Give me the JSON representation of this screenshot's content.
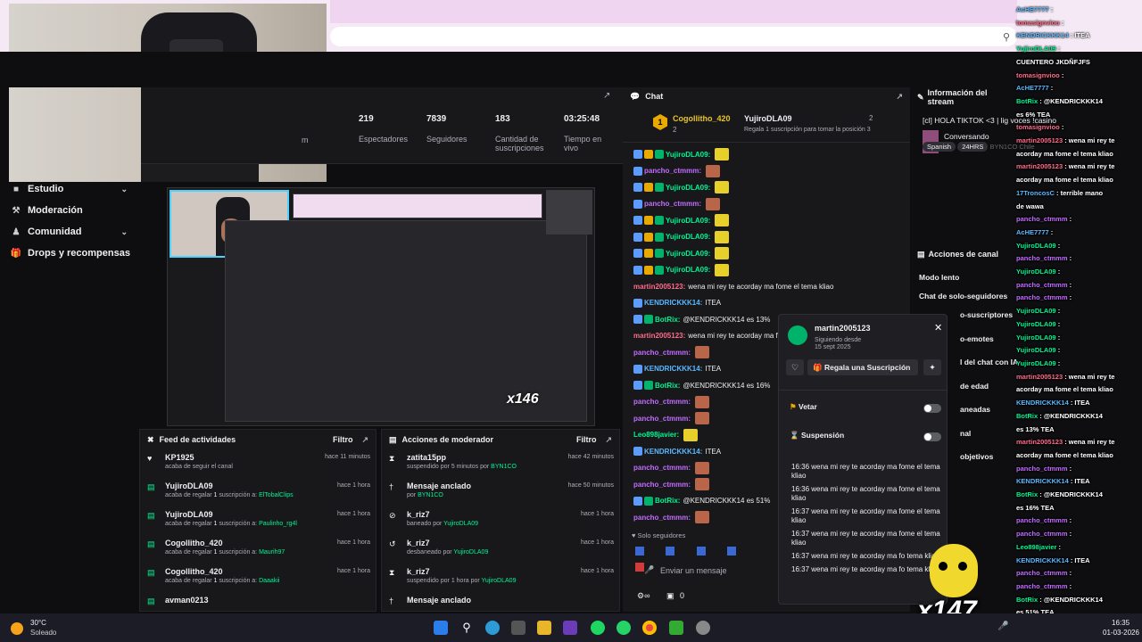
{
  "stats": {
    "m_label": "m",
    "items": [
      {
        "value": "219",
        "label": "Espectadores"
      },
      {
        "value": "7839",
        "label": "Seguidores"
      },
      {
        "value": "183",
        "label": "Cantidad de suscripciones"
      },
      {
        "value": "03:25:48",
        "label": "Tiempo en vivo"
      }
    ]
  },
  "sidebar": {
    "items": [
      {
        "label": "Estudio",
        "icon": "estudio-icon",
        "chevron": true
      },
      {
        "label": "Moderación",
        "icon": "wrench-icon",
        "chevron": false
      },
      {
        "label": "Comunidad",
        "icon": "community-icon",
        "chevron": true
      },
      {
        "label": "Drops y recompensas",
        "icon": "gift-icon",
        "chevron": false
      }
    ]
  },
  "activity_feed": {
    "title": "Feed de actividades",
    "filter": "Filtro",
    "items": [
      {
        "icon": "heart-icon",
        "name": "KP1925",
        "time": "hace 11 minutos",
        "pre": "acaba de seguir el canal",
        "hl": "",
        "post": ""
      },
      {
        "icon": "gift-icon",
        "name": "YujiroDLA09",
        "time": "hace 1 hora",
        "pre": "acaba de regalar ",
        "count": "1",
        "mid": " suscripción a: ",
        "hl": "ElTobalClips"
      },
      {
        "icon": "gift-icon",
        "name": "YujiroDLA09",
        "time": "hace 1 hora",
        "pre": "acaba de regalar ",
        "count": "1",
        "mid": " suscripción a: ",
        "hl": "Paulinho_rg4l"
      },
      {
        "icon": "gift-icon",
        "name": "Cogollitho_420",
        "time": "hace 1 hora",
        "pre": "acaba de regalar ",
        "count": "1",
        "mid": " suscripción a: ",
        "hl": "Maurih97"
      },
      {
        "icon": "gift-icon",
        "name": "Cogollitho_420",
        "time": "hace 1 hora",
        "pre": "acaba de regalar ",
        "count": "1",
        "mid": " suscripción a: ",
        "hl": "Daaakii"
      },
      {
        "icon": "gift-icon",
        "name": "avman0213",
        "time": "",
        "pre": "",
        "count": "",
        "mid": "",
        "hl": ""
      }
    ]
  },
  "mod_actions": {
    "title": "Acciones de moderador",
    "filter": "Filtro",
    "items": [
      {
        "icon": "timeout-icon",
        "name": "zatita15pp",
        "time": "hace 42 minutos",
        "pre": "suspendido por 5 minutos por ",
        "hl": "BYN1CO"
      },
      {
        "icon": "pin-icon",
        "name": "Mensaje anclado",
        "time": "hace 50 minutos",
        "pre": "por ",
        "hl": "BYN1CO"
      },
      {
        "icon": "ban-icon",
        "name": "k_riz7",
        "time": "hace 1 hora",
        "pre": "baneado por ",
        "hl": "YujiroDLA09"
      },
      {
        "icon": "unban-icon",
        "name": "k_riz7",
        "time": "hace 1 hora",
        "pre": "desbaneado por ",
        "hl": "YujiroDLA09"
      },
      {
        "icon": "timeout-icon",
        "name": "k_riz7",
        "time": "hace 1 hora",
        "pre": "suspendido por 1 hora por ",
        "hl": "YujiroDLA09"
      },
      {
        "icon": "pin-icon",
        "name": "Mensaje anclado",
        "time": "",
        "pre": "",
        "hl": ""
      }
    ]
  },
  "chat": {
    "title": "Chat",
    "gift_leader": {
      "name": "Cogollitho_420",
      "count": "2",
      "rank": "1"
    },
    "gift_second": {
      "name": "YujiroDLA09",
      "count": "2"
    },
    "gift_cta": "Regala 1 suscripción para tomar la posición 3",
    "messages": [
      {
        "user": "YujiroDLA09:",
        "color": "#00f593",
        "text": "",
        "emote": "y",
        "badges": [
          "#5c9cff",
          "#e8a900",
          "#00b36b"
        ]
      },
      {
        "user": "pancho_ctmmm:",
        "color": "#c06cff",
        "text": "",
        "emote": "b",
        "badges": [
          "#5c9cff"
        ]
      },
      {
        "user": "YujiroDLA09:",
        "color": "#00f593",
        "text": "",
        "emote": "y",
        "badges": [
          "#5c9cff",
          "#e8a900",
          "#00b36b"
        ]
      },
      {
        "user": "pancho_ctmmm:",
        "color": "#c06cff",
        "text": "",
        "emote": "b",
        "badges": [
          "#5c9cff"
        ]
      },
      {
        "user": "YujiroDLA09:",
        "color": "#00f593",
        "text": "",
        "emote": "y",
        "badges": [
          "#5c9cff",
          "#e8a900",
          "#00b36b"
        ]
      },
      {
        "user": "YujiroDLA09:",
        "color": "#00f593",
        "text": "",
        "emote": "y",
        "badges": [
          "#5c9cff",
          "#e8a900",
          "#00b36b"
        ]
      },
      {
        "user": "YujiroDLA09:",
        "color": "#00f593",
        "text": "",
        "emote": "y",
        "badges": [
          "#5c9cff",
          "#e8a900",
          "#00b36b"
        ]
      },
      {
        "user": "YujiroDLA09:",
        "color": "#00f593",
        "text": "",
        "emote": "y",
        "badges": [
          "#5c9cff",
          "#e8a900",
          "#00b36b"
        ]
      },
      {
        "user": "martin2005123:",
        "color": "#ff6b8a",
        "text": "wena mi rey te acorday ma fome el tema kliao",
        "emote": "",
        "badges": []
      },
      {
        "user": "KENDRICKKK14:",
        "color": "#5ab8ff",
        "text": "ITEA",
        "emote": "",
        "badges": [
          "#5c9cff"
        ]
      },
      {
        "user": "BotRix:",
        "color": "#00f593",
        "text": "@KENDRICKKK14 es 13%",
        "emote": "",
        "badges": [
          "#5c9cff",
          "#00b36b"
        ]
      },
      {
        "user": "martin2005123:",
        "color": "#ff6b8a",
        "text": "wena mi rey te acorday ma fome el tema kliao",
        "emote": "",
        "badges": []
      },
      {
        "user": "pancho_ctmmm:",
        "color": "#c06cff",
        "text": "",
        "emote": "b",
        "badges": []
      },
      {
        "user": "KENDRICKKK14:",
        "color": "#5ab8ff",
        "text": "ITEA",
        "emote": "",
        "badges": [
          "#5c9cff"
        ]
      },
      {
        "user": "BotRix:",
        "color": "#00f593",
        "text": "@KENDRICKKK14 es 16%",
        "emote": "",
        "badges": [
          "#5c9cff",
          "#00b36b"
        ]
      },
      {
        "user": "pancho_ctmmm:",
        "color": "#c06cff",
        "text": "",
        "emote": "b",
        "badges": []
      },
      {
        "user": "pancho_ctmmm:",
        "color": "#c06cff",
        "text": "",
        "emote": "b",
        "badges": []
      },
      {
        "user": "Leo898javier:",
        "color": "#00f593",
        "text": "",
        "emote": "y",
        "badges": []
      },
      {
        "user": "KENDRICKKK14:",
        "color": "#5ab8ff",
        "text": "ITEA",
        "emote": "",
        "badges": [
          "#5c9cff"
        ]
      },
      {
        "user": "pancho_ctmmm:",
        "color": "#c06cff",
        "text": "",
        "emote": "b",
        "badges": []
      },
      {
        "user": "pancho_ctmmm:",
        "color": "#c06cff",
        "text": "",
        "emote": "b",
        "badges": []
      },
      {
        "user": "BotRix:",
        "color": "#00f593",
        "text": "@KENDRICKKK14 es 51%",
        "emote": "",
        "badges": [
          "#5c9cff",
          "#00b36b"
        ]
      },
      {
        "user": "pancho_ctmmm:",
        "color": "#c06cff",
        "text": "",
        "emote": "b",
        "badges": []
      }
    ],
    "followers_only": "Solo seguidores",
    "input_placeholder": "Enviar un mensaje",
    "points": "0"
  },
  "stream_info": {
    "title": "Información del stream",
    "stream_title": "[cl] HOLA TIKTOK <3 | lig",
    "stream_title_tail": "voces !casino",
    "category": "Conversando",
    "tags": [
      "Spanish",
      "24HRS"
    ],
    "tags_faded": [
      "BYN1CO",
      "Chile"
    ]
  },
  "channel_actions": {
    "title": "Acciones de canal",
    "items": [
      "Modo lento",
      "Chat de solo-seguidores",
      "o-suscriptores",
      "o-emotes",
      "l del chat con IA",
      "de edad",
      "aneadas",
      "nal",
      "objetivos"
    ]
  },
  "user_card": {
    "username": "martin2005123",
    "following_label": "Siguiendo desde",
    "following_date": "15 sept 2025",
    "gift_button": "Regala una Suscripción",
    "veto_label": "Vetar",
    "timeout_label": "Suspensión",
    "messages": [
      "16:36 wena mi rey te acorday ma fome el tema kliao",
      "16:36 wena mi rey te acorday ma fome el tema kliao",
      "16:37 wena mi rey te acorday ma fome el tema kliao",
      "16:37 wena mi rey te acorday ma fome el tema kliao",
      "16:37 wena mi rey te acorday ma fo tema kliao",
      "16:37 wena mi rey te acorday ma fo tema kliao"
    ]
  },
  "overlay_chat": [
    {
      "u": "AcHE7777",
      "t": ":",
      "c": "#5ab8ff"
    },
    {
      "u": "tomasignviou",
      "t": ":",
      "c": "#ff6b8a"
    },
    {
      "u": "KENDRICKKK14",
      "t": ": ITEA",
      "c": "#5ab8ff"
    },
    {
      "u": "YujiroDLA09",
      "t": ":",
      "c": "#00f593"
    },
    {
      "u": "",
      "t": "CUENTERO JKDÑFJFS",
      "c": "#fff"
    },
    {
      "u": "tomasignvioo",
      "t": ":",
      "c": "#ff6b8a"
    },
    {
      "u": "AcHE7777",
      "t": ":",
      "c": "#5ab8ff"
    },
    {
      "u": "BotRix",
      "t": ": @KENDRICKKK14",
      "c": "#00f593"
    },
    {
      "u": "",
      "t": "es 6% TEA",
      "c": "#fff"
    },
    {
      "u": "tomasignvioo",
      "t": ":",
      "c": "#ff6b8a"
    },
    {
      "u": "",
      "t": "",
      "c": "#fff"
    },
    {
      "u": "martin2005123",
      "t": ": wena mi rey te",
      "c": "#ff6b8a"
    },
    {
      "u": "",
      "t": "acorday ma fome el tema kliao",
      "c": "#fff"
    },
    {
      "u": "martin2005123",
      "t": ": wena mi rey te",
      "c": "#ff6b8a"
    },
    {
      "u": "",
      "t": "acorday ma fome el tema kliao",
      "c": "#fff"
    },
    {
      "u": "17TroncosC",
      "t": ": terrible mano",
      "c": "#5ab8ff"
    },
    {
      "u": "",
      "t": "de wawa",
      "c": "#fff"
    },
    {
      "u": "pancho_ctmmm",
      "t": ":",
      "c": "#c06cff"
    },
    {
      "u": "AcHE7777",
      "t": ":",
      "c": "#5ab8ff"
    },
    {
      "u": "YujiroDLA09",
      "t": ":",
      "c": "#00f593"
    },
    {
      "u": "pancho_ctmmm",
      "t": ":",
      "c": "#c06cff"
    },
    {
      "u": "YujiroDLA09",
      "t": ":",
      "c": "#00f593"
    },
    {
      "u": "pancho_ctmmm",
      "t": ":",
      "c": "#c06cff"
    },
    {
      "u": "pancho_ctmmm",
      "t": ":",
      "c": "#c06cff"
    },
    {
      "u": "YujiroDLA09",
      "t": ":",
      "c": "#00f593"
    },
    {
      "u": "YujiroDLA09",
      "t": ":",
      "c": "#00f593"
    },
    {
      "u": "YujiroDLA09",
      "t": ":",
      "c": "#00f593"
    },
    {
      "u": "YujiroDLA09",
      "t": ":",
      "c": "#00f593"
    },
    {
      "u": "YujiroDLA09",
      "t": ":",
      "c": "#00f593"
    },
    {
      "u": "martin2005123",
      "t": ": wena mi rey te",
      "c": "#ff6b8a"
    },
    {
      "u": "",
      "t": "acorday ma fome el tema kliao",
      "c": "#fff"
    },
    {
      "u": "KENDRICKKK14",
      "t": ": ITEA",
      "c": "#5ab8ff"
    },
    {
      "u": "BotRix",
      "t": ": @KENDRICKKK14",
      "c": "#00f593"
    },
    {
      "u": "",
      "t": "es 13% TEA",
      "c": "#fff"
    },
    {
      "u": "martin2005123",
      "t": ": wena mi rey te",
      "c": "#ff6b8a"
    },
    {
      "u": "",
      "t": "acorday ma fome el tema kliao",
      "c": "#fff"
    },
    {
      "u": "pancho_ctmmm",
      "t": ":",
      "c": "#c06cff"
    },
    {
      "u": "KENDRICKKK14",
      "t": ": ITEA",
      "c": "#5ab8ff"
    },
    {
      "u": "BotRix",
      "t": ": @KENDRICKKK14",
      "c": "#00f593"
    },
    {
      "u": "",
      "t": "es 16% TEA",
      "c": "#fff"
    },
    {
      "u": "pancho_ctmmm",
      "t": ":",
      "c": "#c06cff"
    },
    {
      "u": "pancho_ctmmm",
      "t": ":",
      "c": "#c06cff"
    },
    {
      "u": "Leo898javier",
      "t": ":",
      "c": "#00f593"
    },
    {
      "u": "KENDRICKKK14",
      "t": ": ITEA",
      "c": "#5ab8ff"
    },
    {
      "u": "pancho_ctmmm",
      "t": ":",
      "c": "#c06cff"
    },
    {
      "u": "pancho_ctmmm",
      "t": ":",
      "c": "#c06cff"
    },
    {
      "u": "BotRix",
      "t": ": @KENDRICKKK14",
      "c": "#00f593"
    },
    {
      "u": "",
      "t": "es 51% TEA",
      "c": "#fff"
    },
    {
      "u": "pancho_ctmmm",
      "t": ":",
      "c": "#c06cff"
    }
  ],
  "alert": {
    "multiplier": "x147",
    "preview_multiplier": "x146"
  },
  "taskbar": {
    "weather_temp": "30°C",
    "weather_desc": "Soleado",
    "time": "16:35",
    "date": "01-03-2026"
  },
  "colors": {
    "accent": "#00f593",
    "brand_bg": "#0e0e10",
    "panel": "#18181b"
  }
}
